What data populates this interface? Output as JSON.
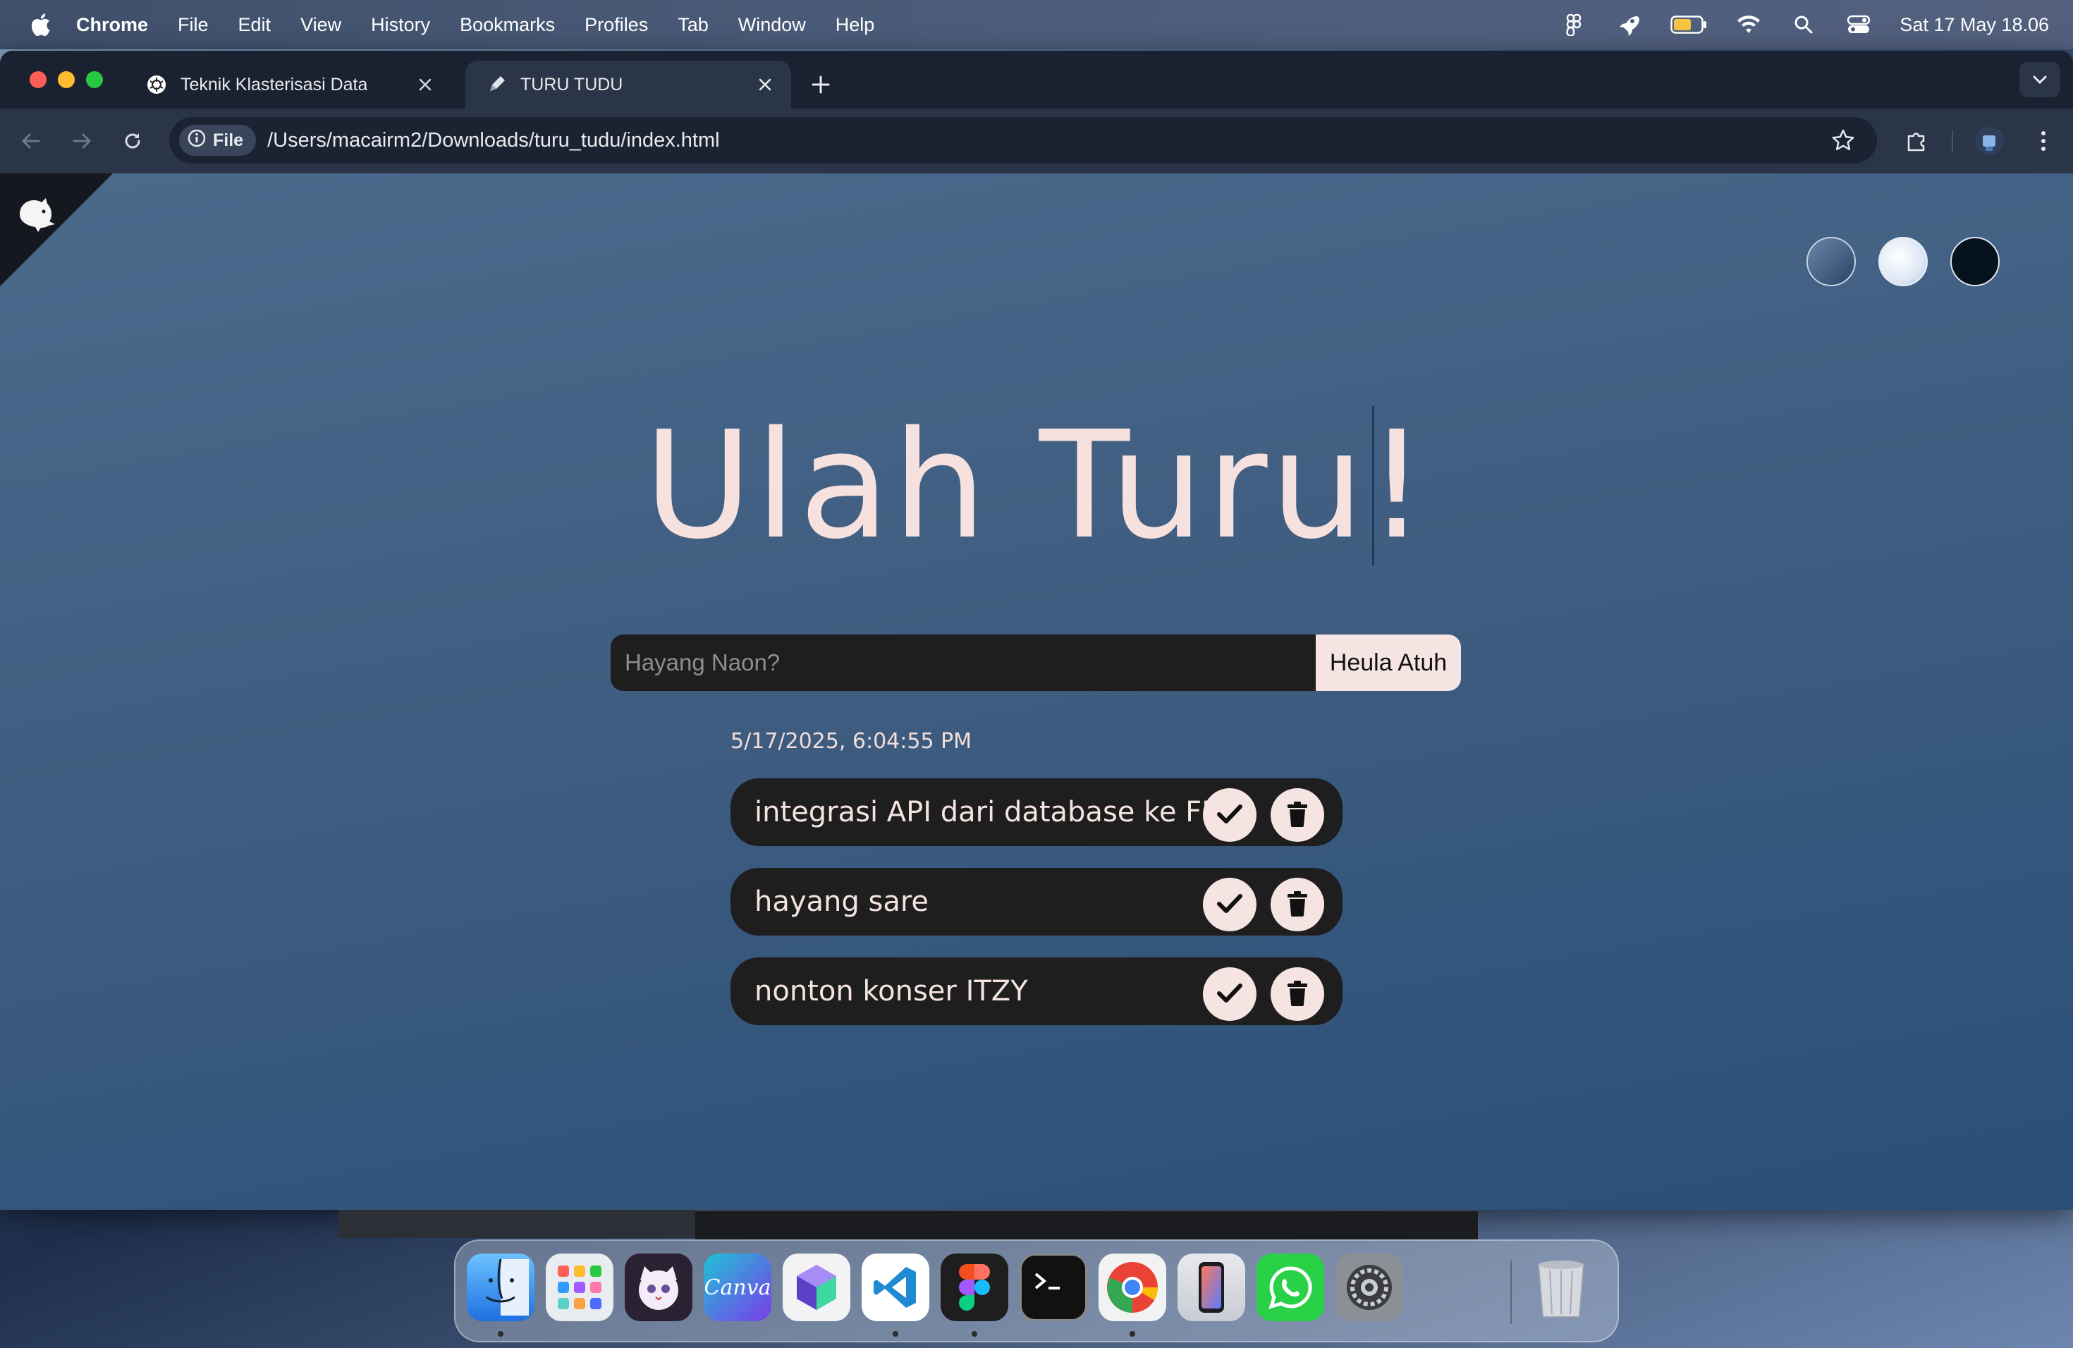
{
  "menubar": {
    "app_name": "Chrome",
    "menus": [
      "File",
      "Edit",
      "View",
      "History",
      "Bookmarks",
      "Profiles",
      "Tab",
      "Window",
      "Help"
    ],
    "status_icons": [
      "figma-icon",
      "rocket-icon",
      "battery-icon",
      "wifi-icon",
      "spotlight-icon",
      "control-center-icon"
    ],
    "clock": "Sat 17 May  18.06"
  },
  "browser": {
    "tabs": [
      {
        "title": "Teknik Klasterisasi Data",
        "favicon": "chatgpt-icon",
        "active": false
      },
      {
        "title": "TURU TUDU",
        "favicon": "pen-icon",
        "active": true
      }
    ],
    "new_tab_label": "+",
    "address": {
      "scheme_chip": "File",
      "url": "/Users/macairm2/Downloads/turu_tudu/index.html"
    }
  },
  "page": {
    "title": "Ulah Turu!",
    "input_placeholder": "Hayang Naon?",
    "input_value": "",
    "add_button_label": "Heula Atuh",
    "datetime": "5/17/2025, 6:04:55 PM",
    "todos": [
      {
        "text": "integrasi API dari database ke FE"
      },
      {
        "text": "hayang sare"
      },
      {
        "text": "nonton konser ITZY"
      }
    ],
    "theme_swatches": [
      "#4f6d90",
      "#f2f6fc",
      "#06121e"
    ],
    "colors": {
      "accent": "#f6e4e2",
      "item_bg": "#1e1e1e",
      "title": "#f7e1de"
    }
  },
  "dock": {
    "apps": [
      "finder",
      "launchpad",
      "cat-app",
      "canva",
      "box-app",
      "vscode",
      "figma",
      "terminal",
      "chrome",
      "iphone-mirroring",
      "whatsapp",
      "system-settings",
      "trash"
    ],
    "canva_label": "Canva"
  }
}
